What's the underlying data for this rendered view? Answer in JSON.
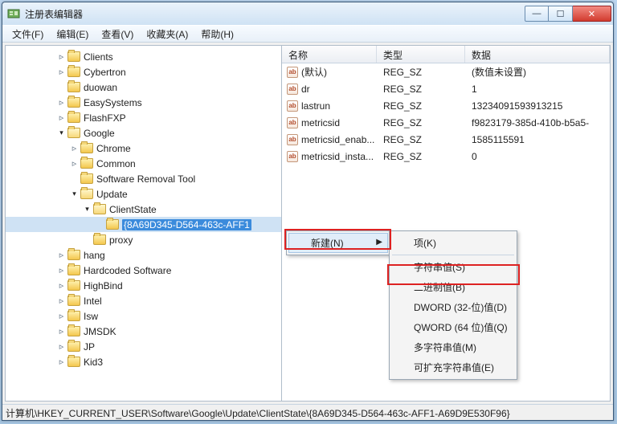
{
  "window": {
    "title": "注册表编辑器"
  },
  "menus": {
    "file": "文件(F)",
    "edit": "编辑(E)",
    "view": "查看(V)",
    "favorites": "收藏夹(A)",
    "help": "帮助(H)"
  },
  "tree": {
    "items": [
      {
        "indent": 4,
        "exp": "▷",
        "label": "Clients"
      },
      {
        "indent": 4,
        "exp": "▷",
        "label": "Cybertron"
      },
      {
        "indent": 4,
        "exp": "",
        "label": "duowan"
      },
      {
        "indent": 4,
        "exp": "▷",
        "label": "EasySystems"
      },
      {
        "indent": 4,
        "exp": "▷",
        "label": "FlashFXP"
      },
      {
        "indent": 4,
        "exp": "▲",
        "label": "Google",
        "open": true
      },
      {
        "indent": 5,
        "exp": "▷",
        "label": "Chrome"
      },
      {
        "indent": 5,
        "exp": "▷",
        "label": "Common"
      },
      {
        "indent": 5,
        "exp": "",
        "label": "Software Removal Tool"
      },
      {
        "indent": 5,
        "exp": "▲",
        "label": "Update",
        "open": true
      },
      {
        "indent": 6,
        "exp": "▲",
        "label": "ClientState",
        "open": true
      },
      {
        "indent": 7,
        "exp": "",
        "label": "{8A69D345-D564-463c-AFF1",
        "selected": true
      },
      {
        "indent": 6,
        "exp": "",
        "label": "proxy"
      },
      {
        "indent": 4,
        "exp": "▷",
        "label": "hang"
      },
      {
        "indent": 4,
        "exp": "▷",
        "label": "Hardcoded Software"
      },
      {
        "indent": 4,
        "exp": "▷",
        "label": "HighBind"
      },
      {
        "indent": 4,
        "exp": "▷",
        "label": "Intel"
      },
      {
        "indent": 4,
        "exp": "▷",
        "label": "Isw"
      },
      {
        "indent": 4,
        "exp": "▷",
        "label": "JMSDK"
      },
      {
        "indent": 4,
        "exp": "▷",
        "label": "JP"
      },
      {
        "indent": 4,
        "exp": "▷",
        "label": "Kid3"
      }
    ]
  },
  "list": {
    "cols": {
      "name": "名称",
      "type": "类型",
      "data": "数据"
    },
    "rows": [
      {
        "name": "(默认)",
        "type": "REG_SZ",
        "data": "(数值未设置)"
      },
      {
        "name": "dr",
        "type": "REG_SZ",
        "data": "1"
      },
      {
        "name": "lastrun",
        "type": "REG_SZ",
        "data": "13234091593913215"
      },
      {
        "name": "metricsid",
        "type": "REG_SZ",
        "data": "f9823179-385d-410b-b5a5-"
      },
      {
        "name": "metricsid_enab...",
        "type": "REG_SZ",
        "data": "1585115591"
      },
      {
        "name": "metricsid_insta...",
        "type": "REG_SZ",
        "data": "0"
      }
    ]
  },
  "context": {
    "main": {
      "new": "新建(N)"
    },
    "sub": {
      "key": "项(K)",
      "string": "字符串值(S)",
      "binary": "二进制值(B)",
      "dword": "DWORD (32-位)值(D)",
      "qword": "QWORD (64 位)值(Q)",
      "multi": "多字符串值(M)",
      "expand": "可扩充字符串值(E)"
    }
  },
  "statusbar": {
    "path": "计算机\\HKEY_CURRENT_USER\\Software\\Google\\Update\\ClientState\\{8A69D345-D564-463c-AFF1-A69D9E530F96}"
  },
  "icons": {
    "val": "ab"
  }
}
